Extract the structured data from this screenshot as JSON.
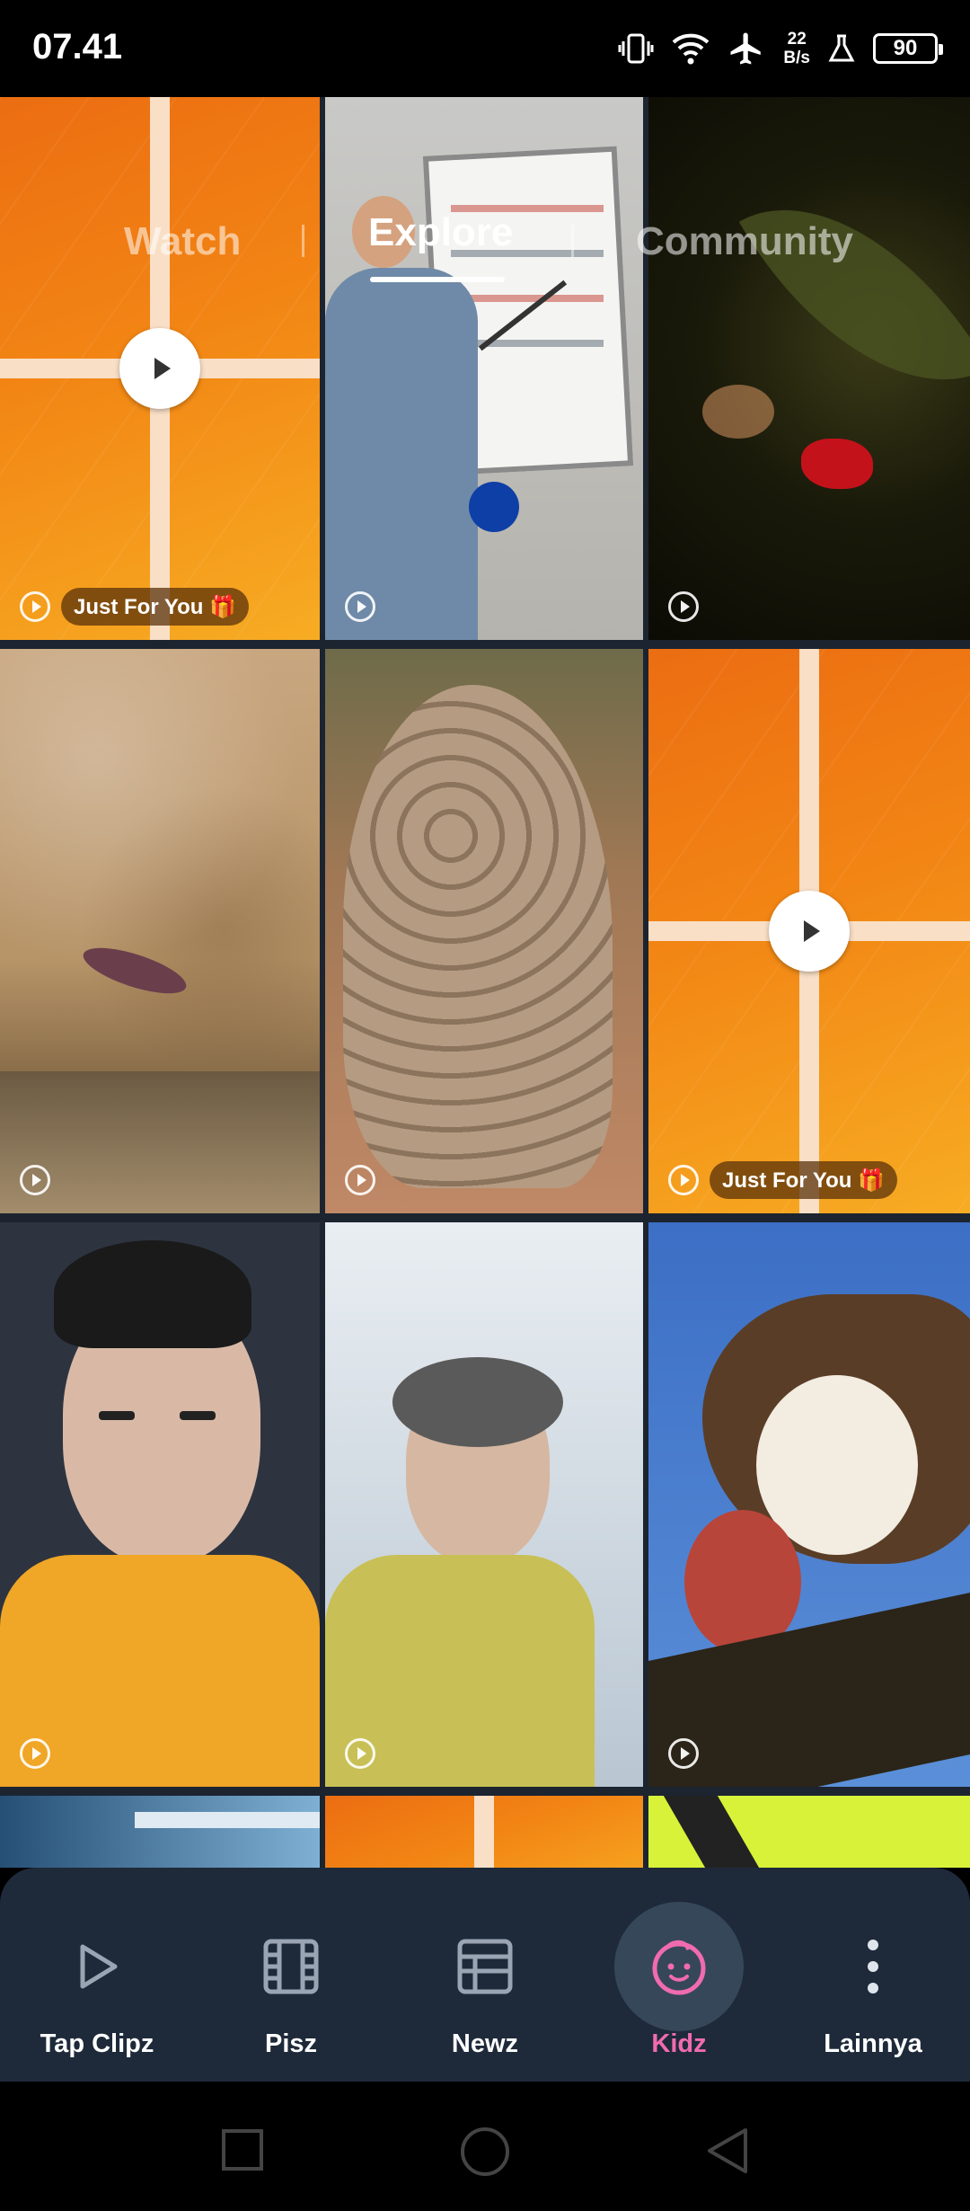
{
  "status_bar": {
    "time": "07.41",
    "net_speed_value": "22",
    "net_speed_unit": "B/s",
    "battery": "90"
  },
  "top_tabs": [
    {
      "label": "Watch",
      "active": false
    },
    {
      "label": "Explore",
      "active": true
    },
    {
      "label": "Community",
      "active": false
    }
  ],
  "video_tiles": [
    {
      "thumbnail": "orange-placeholder",
      "badge": "Just For You 🎁"
    },
    {
      "thumbnail": "teacher-whiteboard-arabic"
    },
    {
      "thumbnail": "red-frog-on-leaf"
    },
    {
      "thumbnail": "crab-on-sand"
    },
    {
      "thumbnail": "pangolin-scales"
    },
    {
      "thumbnail": "orange-placeholder",
      "badge": "Just For You 🎁"
    },
    {
      "thumbnail": "animated-boy-yellow-shirt"
    },
    {
      "thumbnail": "animated-boy-curly-hair"
    },
    {
      "thumbnail": "osprey-eating-bird"
    }
  ],
  "bottom_nav": [
    {
      "label": "Tap Clipz",
      "icon": "play-outline-icon",
      "active": false
    },
    {
      "label": "Pisz",
      "icon": "film-icon",
      "active": false
    },
    {
      "label": "Newz",
      "icon": "newspaper-icon",
      "active": false
    },
    {
      "label": "Kidz",
      "icon": "kid-face-icon",
      "active": true
    },
    {
      "label": "Lainnya",
      "icon": "more-vertical-icon",
      "active": false
    }
  ],
  "system_nav": [
    "recents-button",
    "home-button",
    "back-button"
  ],
  "colors": {
    "accent": "#f06bb0",
    "nav_bg": "#1e2a3a",
    "orange": "#f28514"
  }
}
